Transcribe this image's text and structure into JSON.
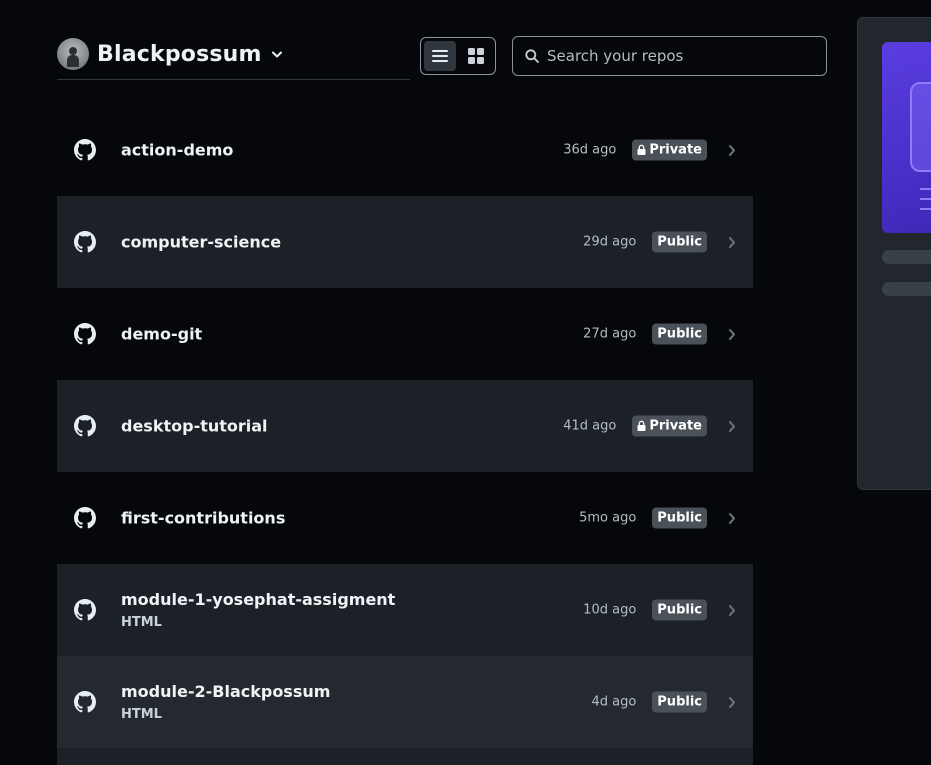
{
  "account": {
    "name": "Blackpossum"
  },
  "view_toggle": {
    "list_label": "List view",
    "grid_label": "Grid view"
  },
  "search": {
    "placeholder": "Search your repos"
  },
  "repos": [
    {
      "name": "action-demo",
      "language": "",
      "updated": "36d ago",
      "visibility": "Private"
    },
    {
      "name": "computer-science",
      "language": "",
      "updated": "29d ago",
      "visibility": "Public"
    },
    {
      "name": "demo-git",
      "language": "",
      "updated": "27d ago",
      "visibility": "Public"
    },
    {
      "name": "desktop-tutorial",
      "language": "",
      "updated": "41d ago",
      "visibility": "Private"
    },
    {
      "name": "first-contributions",
      "language": "",
      "updated": "5mo ago",
      "visibility": "Public"
    },
    {
      "name": "module-1-yosephat-assigment",
      "language": "HTML",
      "updated": "10d ago",
      "visibility": "Public"
    },
    {
      "name": "module-2-Blackpossum",
      "language": "HTML",
      "updated": "4d ago",
      "visibility": "Public"
    }
  ],
  "colors": {
    "background": "#05070b",
    "row_alt": "#1c2128",
    "badge": "#4a5159",
    "promo_accent": "#5b3de0"
  }
}
